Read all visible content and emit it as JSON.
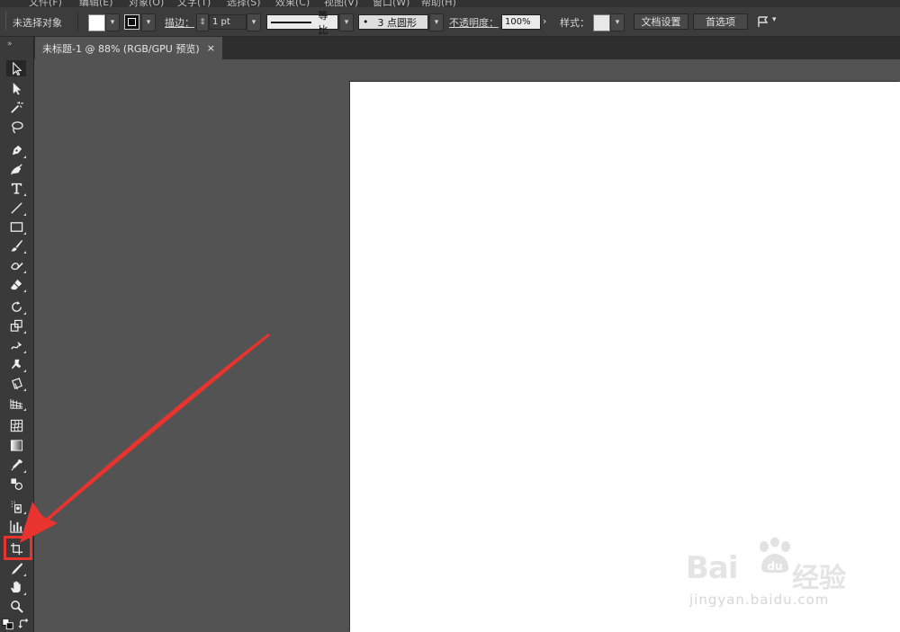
{
  "menubar": {
    "fragments": [
      "文件(F)",
      "编辑(E)",
      "对象(O)",
      "文字(T)",
      "选择(S)",
      "效果(C)",
      "视图(V)",
      "窗口(W)",
      "帮助(H)"
    ]
  },
  "control_bar": {
    "selection_status": "未选择对象",
    "stroke_label": "描边：",
    "stroke_weight": "1 pt",
    "stroke_profile": "等比",
    "brush_dot": "•",
    "brush_label": "3 点圆形",
    "opacity_label": "不透明度：",
    "opacity_value": "100%",
    "style_label": "样式：",
    "doc_setup_button": "文档设置",
    "preferences_button": "首选项",
    "colors": {
      "fill": "#ffffff",
      "stroke": "#111111"
    }
  },
  "document_tab": {
    "title": "未标题-1 @ 88% (RGB/GPU 预览)",
    "close": "×"
  },
  "toolbox": {
    "collapse": "»",
    "tools": [
      "selection",
      "direct-selection",
      "magic-wand",
      "lasso",
      "pen",
      "curvature",
      "type",
      "line-segment",
      "rectangle",
      "paintbrush",
      "shaper",
      "eraser",
      "rotate",
      "scale",
      "warp",
      "puppet-warp",
      "free-transform",
      "perspective-grid",
      "mesh",
      "gradient",
      "eyedropper",
      "blend",
      "symbol-sprayer",
      "column-graph",
      "artboard",
      "slice",
      "hand",
      "zoom"
    ],
    "highlighted_tool": "artboard"
  },
  "annotation": {
    "color": "#e8332f"
  },
  "watermark": {
    "brand": "Bai",
    "brand_tail": "du",
    "cn": "经验",
    "url": "jingyan.baidu.com"
  }
}
